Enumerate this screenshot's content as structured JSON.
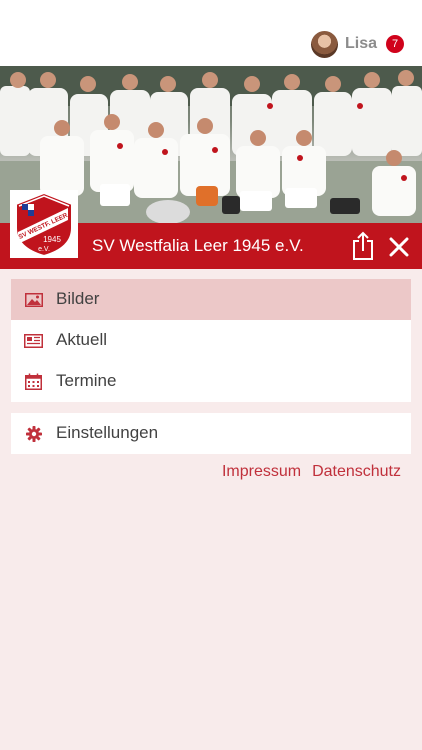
{
  "header": {
    "user_name": "Lisa",
    "notification_count": "7"
  },
  "club": {
    "name": "SV Westfalia Leer 1945 e.V.",
    "logo_text_top": "SV WESTF. LEER",
    "logo_text_year": "1945",
    "logo_text_ev": "e.V."
  },
  "menu": {
    "group1": [
      {
        "label": "Bilder",
        "icon": "image-icon",
        "active": true
      },
      {
        "label": "Aktuell",
        "icon": "newspaper-icon",
        "active": false
      },
      {
        "label": "Termine",
        "icon": "calendar-icon",
        "active": false
      }
    ],
    "group2": [
      {
        "label": "Einstellungen",
        "icon": "gear-icon",
        "active": false
      }
    ]
  },
  "footer": {
    "impressum": "Impressum",
    "datenschutz": "Datenschutz"
  },
  "colors": {
    "brand_red": "#c0141d",
    "background": "#f8ebeb",
    "active_item": "#ecc8c8",
    "icon_red": "#c0303b"
  }
}
